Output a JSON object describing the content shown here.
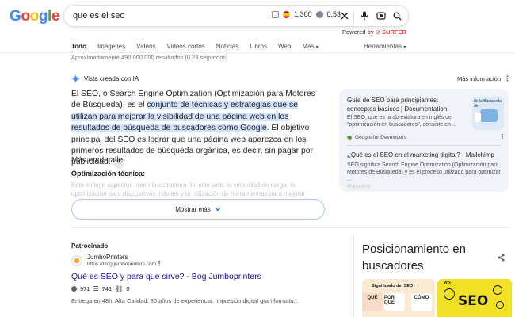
{
  "logo": {
    "letters": [
      "G",
      "o",
      "o",
      "g",
      "l",
      "e"
    ]
  },
  "search": {
    "query": "que es el seo",
    "volume": "1,300",
    "difficulty": "0.53"
  },
  "powered": {
    "prefix": "Powered by",
    "brand": "SURFER"
  },
  "tabs": [
    "Todo",
    "Imágenes",
    "Videos",
    "Videos cortos",
    "Noticias",
    "Libros",
    "Web",
    "Más"
  ],
  "tools_label": "Herramientas",
  "results_count": "Aproximadamente 490.000.000 resultados (0,23 segundos)",
  "ai_overview": {
    "header": "Vista creada con IA",
    "more_info": "Más información",
    "text_before": "El SEO, o Search Engine Optimization (Optimización para Motores de Búsqueda), es el ",
    "text_highlight": "conjunto de técnicas y estrategias que se utilizan para mejorar la visibilidad de una página web en los resultados de búsqueda de buscadores como Google",
    "text_after": ". El objetivo principal del SEO es lograr que una página web aparezca en los primeros resultados de búsqueda orgánica, es decir, sin pagar por publicidad.",
    "more_detail": "Más en detalle:",
    "subheading": "Optimización técnica:",
    "faded_text": "Esto incluye aspectos como la estructura del sitio web, la velocidad de carga, la optimización para dispositivos móviles y la utilización de herramientas para mejorar",
    "show_more": "Mostrar más"
  },
  "sources": [
    {
      "title": "Guía de SEO para principiantes: conceptos básicos | Documentation",
      "snippet": "El SEO, que es la abreviatura en inglés de \"optimización en buscadores\", consiste en ...",
      "site": "Google for Developers",
      "thumb_label": "de la Búsqueda de"
    },
    {
      "title": "¿Qué es el SEO en el marketing digital? - Mailchimp",
      "snippet": "SEO significa Search Engine Optimization (Optimización para Motores de Búsqueda) y es el proceso utilizado para optimizar ...",
      "site": "Mailchimp"
    }
  ],
  "ad": {
    "label": "Patrocinado",
    "site_name": "JumboPrinters",
    "url": "https://blog.jumboprinters.com",
    "title": "Qué es SEO y para que sirve? - Bog Jumboprinters",
    "metric1": "971",
    "metric2": "741",
    "metric3": "0",
    "description": "Entrega en 48h. Alta Calidad. 80 años de experiencia. Impresión digital gran formato..."
  },
  "knowledge_panel": {
    "title": "Posicionamiento en buscadores",
    "img1_title": "Significado del SEO",
    "img1_pills": [
      "QUÉ",
      "POR QUÉ",
      "CÓMO"
    ],
    "img2_text": "SEO",
    "img2_label": "Wix"
  },
  "colors": {
    "link": "#1a0dab",
    "highlight": "#d3e3fd",
    "source_panel": "#f0f4f9",
    "surfer_brand": "#e8412f"
  }
}
